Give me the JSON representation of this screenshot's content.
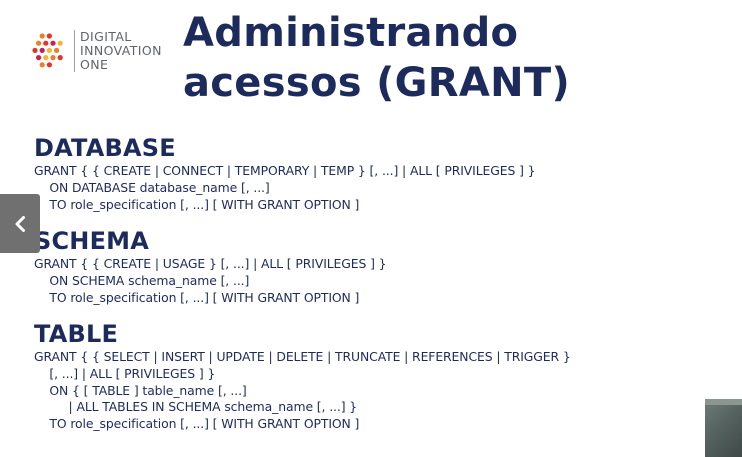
{
  "logo": {
    "lines": [
      "DIGITAL",
      "INNOVATION",
      "ONE"
    ],
    "colors": [
      "#f9b233",
      "#ef7d22",
      "#e6332a",
      "#c81f5b"
    ]
  },
  "title": {
    "line1": "Administrando",
    "line2": "acessos (GRANT)"
  },
  "sections": [
    {
      "heading": "DATABASE",
      "lines": [
        "GRANT { { CREATE | CONNECT | TEMPORARY | TEMP } [, ...] | ALL [ PRIVILEGES ] }",
        "    ON DATABASE database_name [, ...]",
        "    TO role_specification [, ...] [ WITH GRANT OPTION ]"
      ]
    },
    {
      "heading": "SCHEMA",
      "lines": [
        "GRANT { { CREATE | USAGE } [, ...] | ALL [ PRIVILEGES ] }",
        "    ON SCHEMA schema_name [, ...]",
        "    TO role_specification [, ...] [ WITH GRANT OPTION ]"
      ]
    },
    {
      "heading": "TABLE",
      "lines": [
        "GRANT { { SELECT | INSERT | UPDATE | DELETE | TRUNCATE | REFERENCES | TRIGGER }",
        "    [, ...] | ALL [ PRIVILEGES ] }",
        "    ON { [ TABLE ] table_name [, ...]",
        "         | ALL TABLES IN SCHEMA schema_name [, ...] }",
        "    TO role_specification [, ...] [ WITH GRANT OPTION ]"
      ]
    }
  ],
  "nav": {
    "prev_icon": "chevron-left-icon",
    "background": "#707070"
  },
  "theme": {
    "text_color": "#1d2a5c",
    "logo_text_color": "#5f6368"
  }
}
